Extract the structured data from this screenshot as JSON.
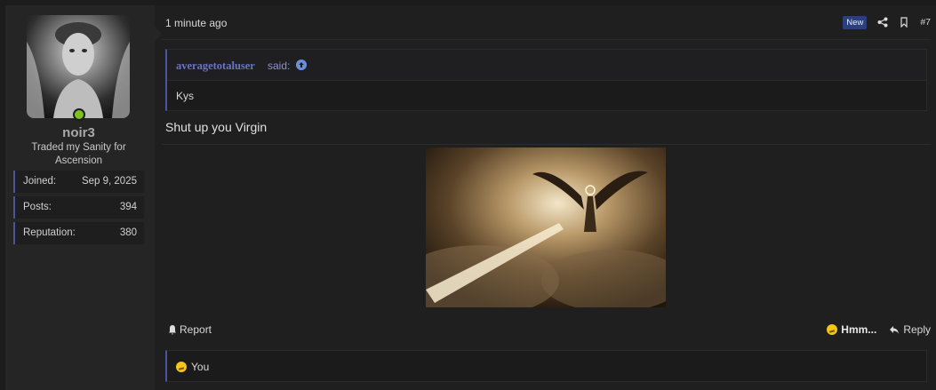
{
  "user": {
    "username": "noir3",
    "title": "Traded my Sanity for Ascension",
    "status_color": "#7cc11f",
    "stats": [
      {
        "key": "Joined:",
        "value": "Sep 9, 2025"
      },
      {
        "key": "Posts:",
        "value": "394"
      },
      {
        "key": "Reputation:",
        "value": "380"
      }
    ]
  },
  "post": {
    "time": "1 minute ago",
    "badge": "New",
    "number": "#7",
    "share_icon": "share-icon",
    "bookmark_icon": "bookmark-icon",
    "quote": {
      "author": "averagetotaluser",
      "said": "said:",
      "up_icon": "arrow-up-circle-icon",
      "body": "Kys"
    },
    "message": "Shut up you Virgin",
    "footer": {
      "report": "Report",
      "reaction": "Hmm...",
      "reply": "Reply"
    },
    "reactions_bar": {
      "label": "You"
    }
  },
  "colors": {
    "accent": "#4a55a0",
    "quote_author": "#6a73c5",
    "badge_bg": "#2b3f7a",
    "online": "#7cc11f"
  }
}
